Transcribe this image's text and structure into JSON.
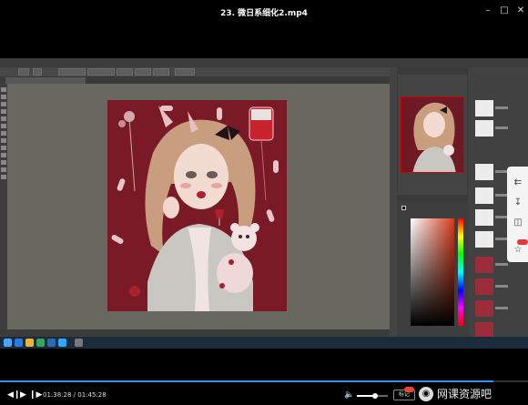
{
  "window": {
    "title": "23. 微日系细化2.mp4",
    "minimize_icon": "minimize-icon",
    "maximize_icon": "maximize-icon",
    "close_icon": "close-icon"
  },
  "photoshop": {
    "document_tab": "",
    "panel_title_navigator": "",
    "colors": {
      "app_bg": "#535353",
      "canvas_bg": "#686861",
      "artwork_bg": "#7a1a27",
      "panel_bg": "#3b3b3b"
    }
  },
  "side_tools": {
    "items": [
      "share-icon",
      "download-icon",
      "trash-icon",
      "pin-icon"
    ]
  },
  "player": {
    "time_display": "01:38:28 / 01:45:28",
    "mark_button": "标记",
    "progress_fraction": 0.934,
    "volume_fraction": 0.6,
    "icons": [
      "prev-icon",
      "play-icon",
      "next-icon",
      "volume-icon"
    ]
  },
  "watermark": {
    "text": "网课资源吧"
  }
}
